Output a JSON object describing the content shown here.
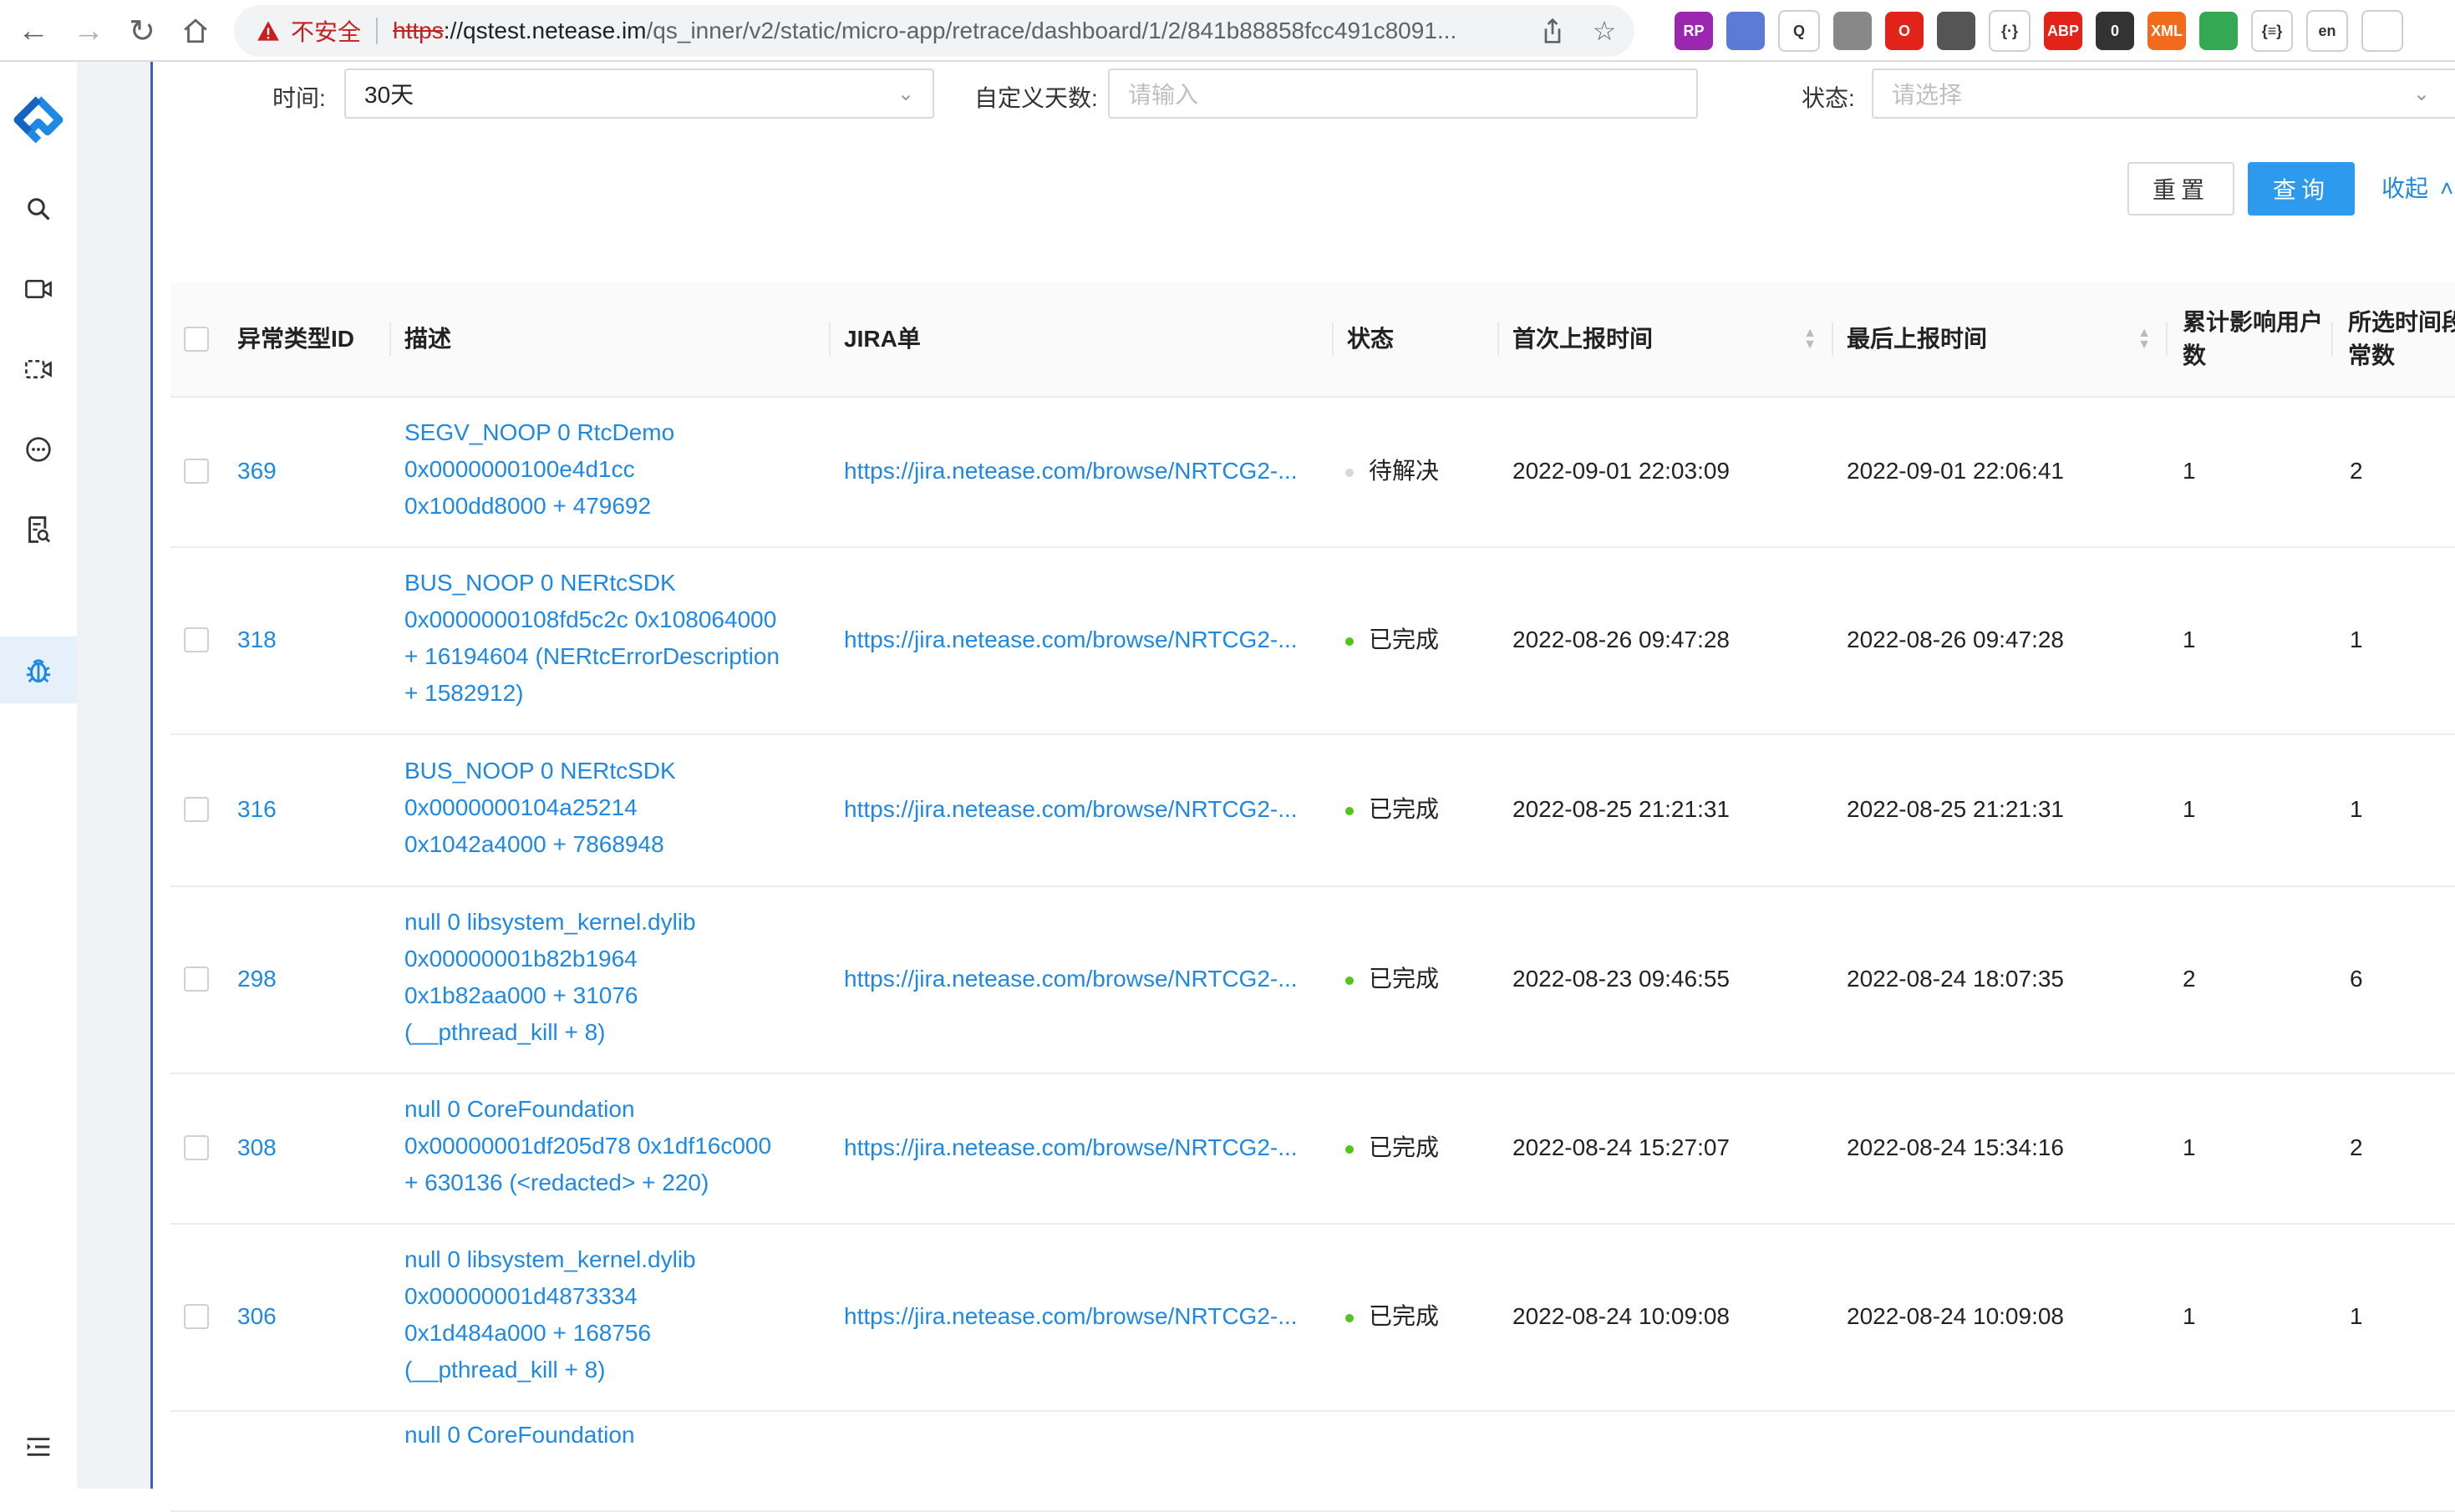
{
  "browser": {
    "security_label": "不安全",
    "url_protocol": "https",
    "url_host": "://qstest.netease.im",
    "url_path": "/qs_inner/v2/static/micro-app/retrace/dashboard/1/2/841b88858fcc491c8091...",
    "extensions": [
      {
        "name": "rp",
        "label": "RP",
        "color": "#9b27b0"
      },
      {
        "name": "ext2",
        "label": "",
        "color": "#5b7bd5"
      },
      {
        "name": "ext3",
        "label": "Q",
        "color": "#ffffff"
      },
      {
        "name": "ext4",
        "label": "",
        "color": "#888888"
      },
      {
        "name": "opera",
        "label": "O",
        "color": "#e2231a"
      },
      {
        "name": "gear",
        "label": "",
        "color": "#555555"
      },
      {
        "name": "json",
        "label": "{·}",
        "color": "#ffffff"
      },
      {
        "name": "adblock",
        "label": "ABP",
        "color": "#e2231a"
      },
      {
        "name": "zero",
        "label": "0",
        "color": "#333333"
      },
      {
        "name": "xml",
        "label": "XML",
        "color": "#f26b1d"
      },
      {
        "name": "chrome",
        "label": "",
        "color": "#34a853"
      },
      {
        "name": "braces",
        "label": "{≡}",
        "color": "#ffffff"
      },
      {
        "name": "lang",
        "label": "en",
        "color": "#ffffff"
      },
      {
        "name": "puzzle",
        "label": "",
        "color": "#ffffff"
      }
    ]
  },
  "colors": {
    "primary": "#2d9aee",
    "link": "#1e88e5",
    "status_done": "#52c41a",
    "status_pending": "#d9d9d9"
  },
  "filters": {
    "time_label": "时间:",
    "time_value": "30天",
    "custom_days_label": "自定义天数:",
    "custom_days_placeholder": "请输入",
    "status_label": "状态:",
    "status_placeholder": "请选择"
  },
  "buttons": {
    "reset": "重置",
    "query": "查询",
    "collapse": "收起"
  },
  "table": {
    "headers": {
      "id": "异常类型ID",
      "desc": "描述",
      "jira": "JIRA单",
      "status": "状态",
      "first": "首次上报时间",
      "last": "最后上报时间",
      "users_1": "累计影响用户",
      "users_2": "数",
      "count_1": "所选时间段",
      "count_2": "常数"
    },
    "rows": [
      {
        "id": "369",
        "desc": [
          "SEGV_NOOP 0 RtcDemo",
          "0x0000000100e4d1cc",
          "0x100dd8000 + 479692"
        ],
        "jira": "https://jira.netease.com/browse/NRTCG2-...",
        "status": "待解决",
        "status_kind": "pending",
        "first": "2022-09-01 22:03:09",
        "last": "2022-09-01 22:06:41",
        "users": "1",
        "count": "2"
      },
      {
        "id": "318",
        "desc": [
          "BUS_NOOP 0 NERtcSDK",
          "0x0000000108fd5c2c 0x108064000",
          "+ 16194604 (NERtcErrorDescription",
          "+ 1582912)"
        ],
        "jira": "https://jira.netease.com/browse/NRTCG2-...",
        "status": "已完成",
        "status_kind": "done",
        "first": "2022-08-26 09:47:28",
        "last": "2022-08-26 09:47:28",
        "users": "1",
        "count": "1"
      },
      {
        "id": "316",
        "desc": [
          "BUS_NOOP 0 NERtcSDK",
          "0x0000000104a25214",
          "0x1042a4000 + 7868948"
        ],
        "jira": "https://jira.netease.com/browse/NRTCG2-...",
        "status": "已完成",
        "status_kind": "done",
        "first": "2022-08-25 21:21:31",
        "last": "2022-08-25 21:21:31",
        "users": "1",
        "count": "1"
      },
      {
        "id": "298",
        "desc": [
          "null 0 libsystem_kernel.dylib",
          "0x00000001b82b1964",
          "0x1b82aa000 + 31076",
          "(__pthread_kill + 8)"
        ],
        "jira": "https://jira.netease.com/browse/NRTCG2-...",
        "status": "已完成",
        "status_kind": "done",
        "first": "2022-08-23 09:46:55",
        "last": "2022-08-24 18:07:35",
        "users": "2",
        "count": "6"
      },
      {
        "id": "308",
        "desc": [
          "null 0 CoreFoundation",
          "0x00000001df205d78 0x1df16c000",
          "+ 630136 (<redacted> + 220)"
        ],
        "jira": "https://jira.netease.com/browse/NRTCG2-...",
        "status": "已完成",
        "status_kind": "done",
        "first": "2022-08-24 15:27:07",
        "last": "2022-08-24 15:34:16",
        "users": "1",
        "count": "2"
      },
      {
        "id": "306",
        "desc": [
          "null 0 libsystem_kernel.dylib",
          "0x00000001d4873334",
          "0x1d484a000 + 168756",
          "(__pthread_kill + 8)"
        ],
        "jira": "https://jira.netease.com/browse/NRTCG2-...",
        "status": "已完成",
        "status_kind": "done",
        "first": "2022-08-24 10:09:08",
        "last": "2022-08-24 10:09:08",
        "users": "1",
        "count": "1"
      },
      {
        "id": "",
        "desc": [
          "null 0 CoreFoundation"
        ],
        "jira": "",
        "status": "",
        "status_kind": "",
        "first": "",
        "last": "",
        "users": "",
        "count": ""
      }
    ]
  }
}
